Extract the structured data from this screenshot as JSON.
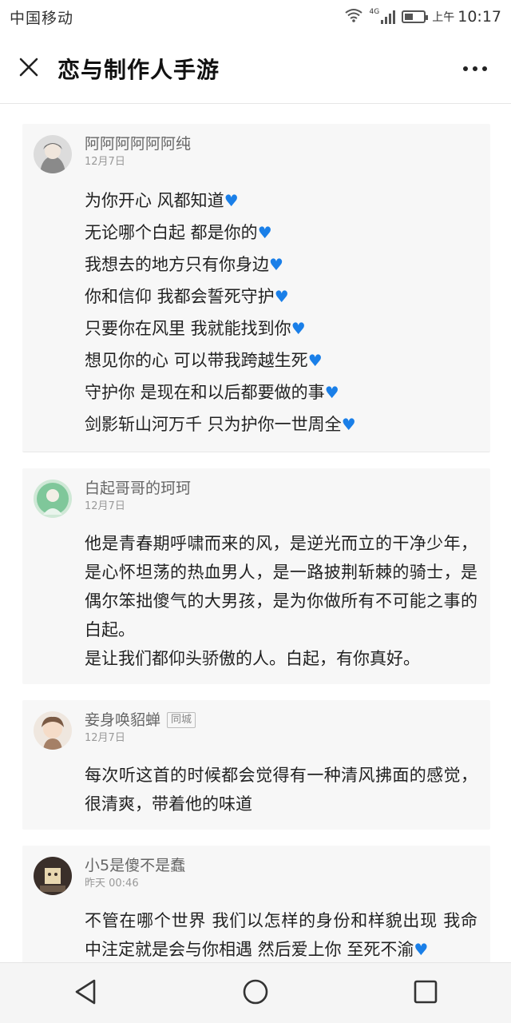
{
  "status_bar": {
    "carrier": "中国移动",
    "network": "4G",
    "ampm": "上午",
    "time": "10:17"
  },
  "header": {
    "title": "恋与制作人手游"
  },
  "comments": [
    {
      "username": "阿阿阿阿阿阿纯",
      "date": "12月7日",
      "lines": [
        "为你开心 风都知道💙",
        "无论哪个白起 都是你的💙",
        "我想去的地方只有你身边💙",
        "你和信仰 我都会誓死守护💙",
        "只要你在风里 我就能找到你💙",
        "想见你的心 可以带我跨越生死💙",
        "守护你 是现在和以后都要做的事💙",
        "剑影斩山河万千 只为护你一世周全💙"
      ]
    },
    {
      "username": "白起哥哥的珂珂",
      "date": "12月7日",
      "paragraphs": [
        "他是青春期呼啸而来的风，是逆光而立的干净少年，是心怀坦荡的热血男人，是一路披荆斩棘的骑士，是偶尔笨拙傻气的大男孩，是为你做所有不可能之事的白起。",
        "是让我们都仰头骄傲的人。白起，有你真好。"
      ]
    },
    {
      "username": "妾身唤貂蝉",
      "tag": "同城",
      "date": "12月7日",
      "paragraphs": [
        "每次听这首的时候都会觉得有一种清风拂面的感觉，很清爽，带着他的味道"
      ]
    },
    {
      "username": "小5是傻不是蠢",
      "date": "昨天 00:46",
      "paragraphs": [
        "不管在哪个世界 我们以怎样的身份和样貌出现 我命中注定就是会与你相遇 然后爱上你 至死不渝💙"
      ]
    }
  ],
  "icons": {
    "close": "close-icon",
    "more": "more-icon",
    "back": "back-triangle-icon",
    "home": "home-circle-icon",
    "recents": "recents-square-icon",
    "wifi": "wifi-icon",
    "signal": "signal-icon",
    "battery": "battery-icon"
  },
  "colors": {
    "heart": "#1a7fe8",
    "card_bg": "#f7f7f7",
    "nav_bg": "#f5f5f5"
  }
}
